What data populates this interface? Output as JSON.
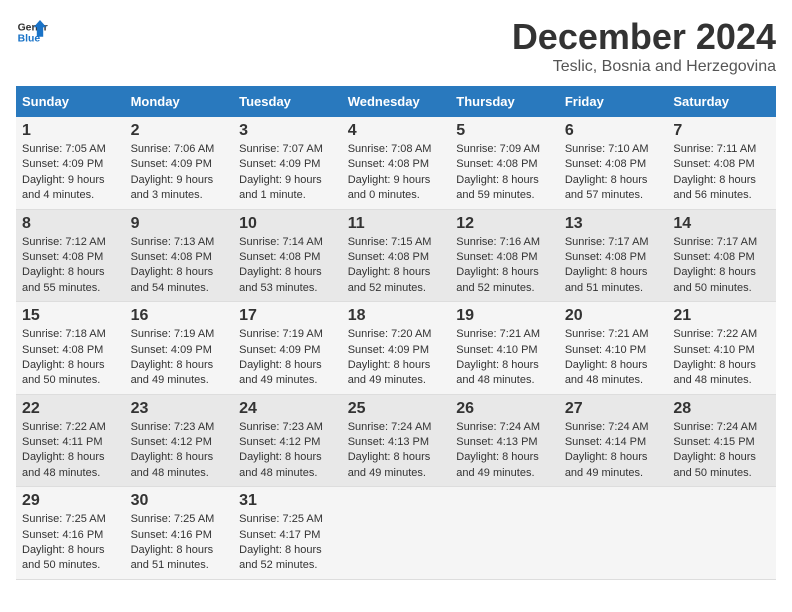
{
  "logo": {
    "line1": "General",
    "line2": "Blue"
  },
  "title": "December 2024",
  "subtitle": "Teslic, Bosnia and Herzegovina",
  "days_of_week": [
    "Sunday",
    "Monday",
    "Tuesday",
    "Wednesday",
    "Thursday",
    "Friday",
    "Saturday"
  ],
  "weeks": [
    [
      {
        "day": 1,
        "sunrise": "7:05 AM",
        "sunset": "4:09 PM",
        "daylight": "9 hours and 4 minutes."
      },
      {
        "day": 2,
        "sunrise": "7:06 AM",
        "sunset": "4:09 PM",
        "daylight": "9 hours and 3 minutes."
      },
      {
        "day": 3,
        "sunrise": "7:07 AM",
        "sunset": "4:09 PM",
        "daylight": "9 hours and 1 minute."
      },
      {
        "day": 4,
        "sunrise": "7:08 AM",
        "sunset": "4:08 PM",
        "daylight": "9 hours and 0 minutes."
      },
      {
        "day": 5,
        "sunrise": "7:09 AM",
        "sunset": "4:08 PM",
        "daylight": "8 hours and 59 minutes."
      },
      {
        "day": 6,
        "sunrise": "7:10 AM",
        "sunset": "4:08 PM",
        "daylight": "8 hours and 57 minutes."
      },
      {
        "day": 7,
        "sunrise": "7:11 AM",
        "sunset": "4:08 PM",
        "daylight": "8 hours and 56 minutes."
      }
    ],
    [
      {
        "day": 8,
        "sunrise": "7:12 AM",
        "sunset": "4:08 PM",
        "daylight": "8 hours and 55 minutes."
      },
      {
        "day": 9,
        "sunrise": "7:13 AM",
        "sunset": "4:08 PM",
        "daylight": "8 hours and 54 minutes."
      },
      {
        "day": 10,
        "sunrise": "7:14 AM",
        "sunset": "4:08 PM",
        "daylight": "8 hours and 53 minutes."
      },
      {
        "day": 11,
        "sunrise": "7:15 AM",
        "sunset": "4:08 PM",
        "daylight": "8 hours and 52 minutes."
      },
      {
        "day": 12,
        "sunrise": "7:16 AM",
        "sunset": "4:08 PM",
        "daylight": "8 hours and 52 minutes."
      },
      {
        "day": 13,
        "sunrise": "7:17 AM",
        "sunset": "4:08 PM",
        "daylight": "8 hours and 51 minutes."
      },
      {
        "day": 14,
        "sunrise": "7:17 AM",
        "sunset": "4:08 PM",
        "daylight": "8 hours and 50 minutes."
      }
    ],
    [
      {
        "day": 15,
        "sunrise": "7:18 AM",
        "sunset": "4:08 PM",
        "daylight": "8 hours and 50 minutes."
      },
      {
        "day": 16,
        "sunrise": "7:19 AM",
        "sunset": "4:09 PM",
        "daylight": "8 hours and 49 minutes."
      },
      {
        "day": 17,
        "sunrise": "7:19 AM",
        "sunset": "4:09 PM",
        "daylight": "8 hours and 49 minutes."
      },
      {
        "day": 18,
        "sunrise": "7:20 AM",
        "sunset": "4:09 PM",
        "daylight": "8 hours and 49 minutes."
      },
      {
        "day": 19,
        "sunrise": "7:21 AM",
        "sunset": "4:10 PM",
        "daylight": "8 hours and 48 minutes."
      },
      {
        "day": 20,
        "sunrise": "7:21 AM",
        "sunset": "4:10 PM",
        "daylight": "8 hours and 48 minutes."
      },
      {
        "day": 21,
        "sunrise": "7:22 AM",
        "sunset": "4:10 PM",
        "daylight": "8 hours and 48 minutes."
      }
    ],
    [
      {
        "day": 22,
        "sunrise": "7:22 AM",
        "sunset": "4:11 PM",
        "daylight": "8 hours and 48 minutes."
      },
      {
        "day": 23,
        "sunrise": "7:23 AM",
        "sunset": "4:12 PM",
        "daylight": "8 hours and 48 minutes."
      },
      {
        "day": 24,
        "sunrise": "7:23 AM",
        "sunset": "4:12 PM",
        "daylight": "8 hours and 48 minutes."
      },
      {
        "day": 25,
        "sunrise": "7:24 AM",
        "sunset": "4:13 PM",
        "daylight": "8 hours and 49 minutes."
      },
      {
        "day": 26,
        "sunrise": "7:24 AM",
        "sunset": "4:13 PM",
        "daylight": "8 hours and 49 minutes."
      },
      {
        "day": 27,
        "sunrise": "7:24 AM",
        "sunset": "4:14 PM",
        "daylight": "8 hours and 49 minutes."
      },
      {
        "day": 28,
        "sunrise": "7:24 AM",
        "sunset": "4:15 PM",
        "daylight": "8 hours and 50 minutes."
      }
    ],
    [
      {
        "day": 29,
        "sunrise": "7:25 AM",
        "sunset": "4:16 PM",
        "daylight": "8 hours and 50 minutes."
      },
      {
        "day": 30,
        "sunrise": "7:25 AM",
        "sunset": "4:16 PM",
        "daylight": "8 hours and 51 minutes."
      },
      {
        "day": 31,
        "sunrise": "7:25 AM",
        "sunset": "4:17 PM",
        "daylight": "8 hours and 52 minutes."
      },
      null,
      null,
      null,
      null
    ]
  ],
  "labels": {
    "sunrise": "Sunrise:",
    "sunset": "Sunset:",
    "daylight": "Daylight:"
  }
}
